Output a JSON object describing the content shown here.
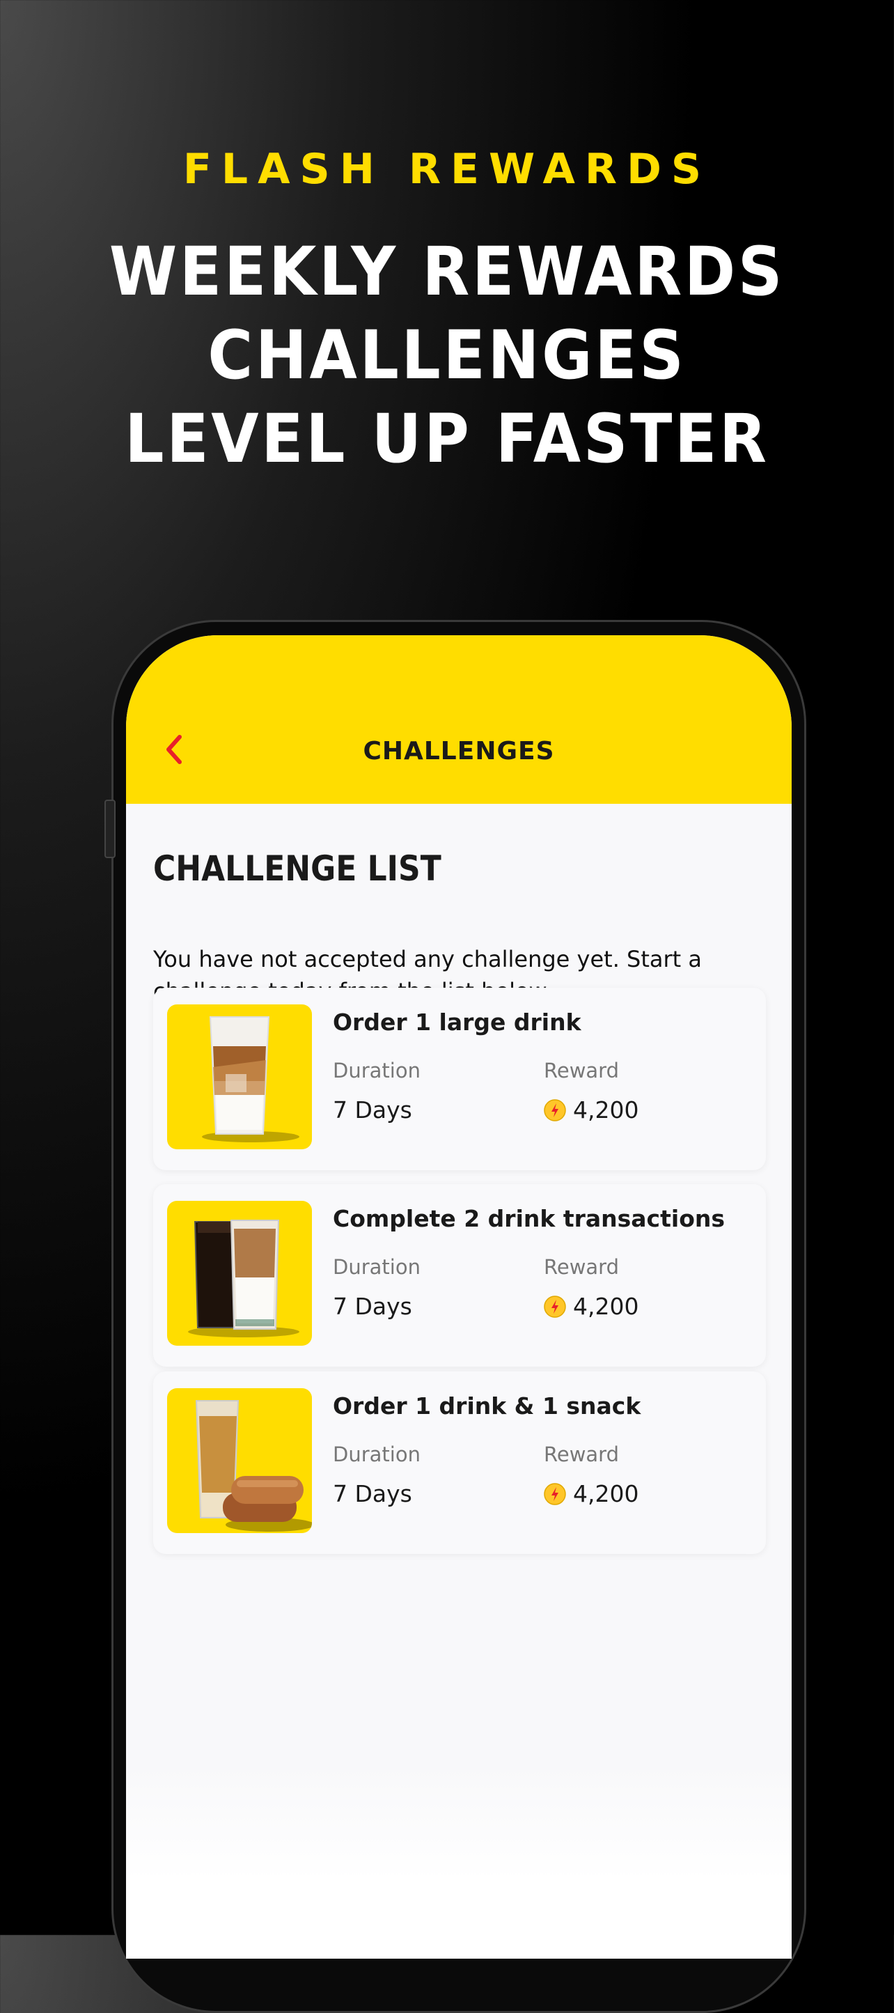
{
  "promo": {
    "kicker": "FLASH REWARDS",
    "headline": [
      "WEEKLY REWARDS",
      "CHALLENGES",
      "LEVEL UP FASTER"
    ]
  },
  "app": {
    "nav_title": "CHALLENGES",
    "list_title": "CHALLENGE LIST",
    "intro_text": "You have not accepted any challenge yet. Start a challenge today from the list below.",
    "challenges": [
      {
        "title": "Order 1 large drink",
        "duration_label": "Duration",
        "duration": "7 Days",
        "reward_label": "Reward",
        "reward": "4,200",
        "image": "iced-latte-image"
      },
      {
        "title": "Complete 2 drink transactions",
        "duration_label": "Duration",
        "duration": "7 Days",
        "reward_label": "Reward",
        "reward": "4,200",
        "image": "two-coffees-image"
      },
      {
        "title": "Order 1 drink & 1 snack",
        "duration_label": "Duration",
        "duration": "7 Days",
        "reward_label": "Reward",
        "reward": "4,200",
        "image": "drink-and-snack-image"
      }
    ]
  },
  "colors": {
    "brand_yellow": "#FFDD00",
    "back_arrow": "#E8202A",
    "background": "#000000"
  }
}
